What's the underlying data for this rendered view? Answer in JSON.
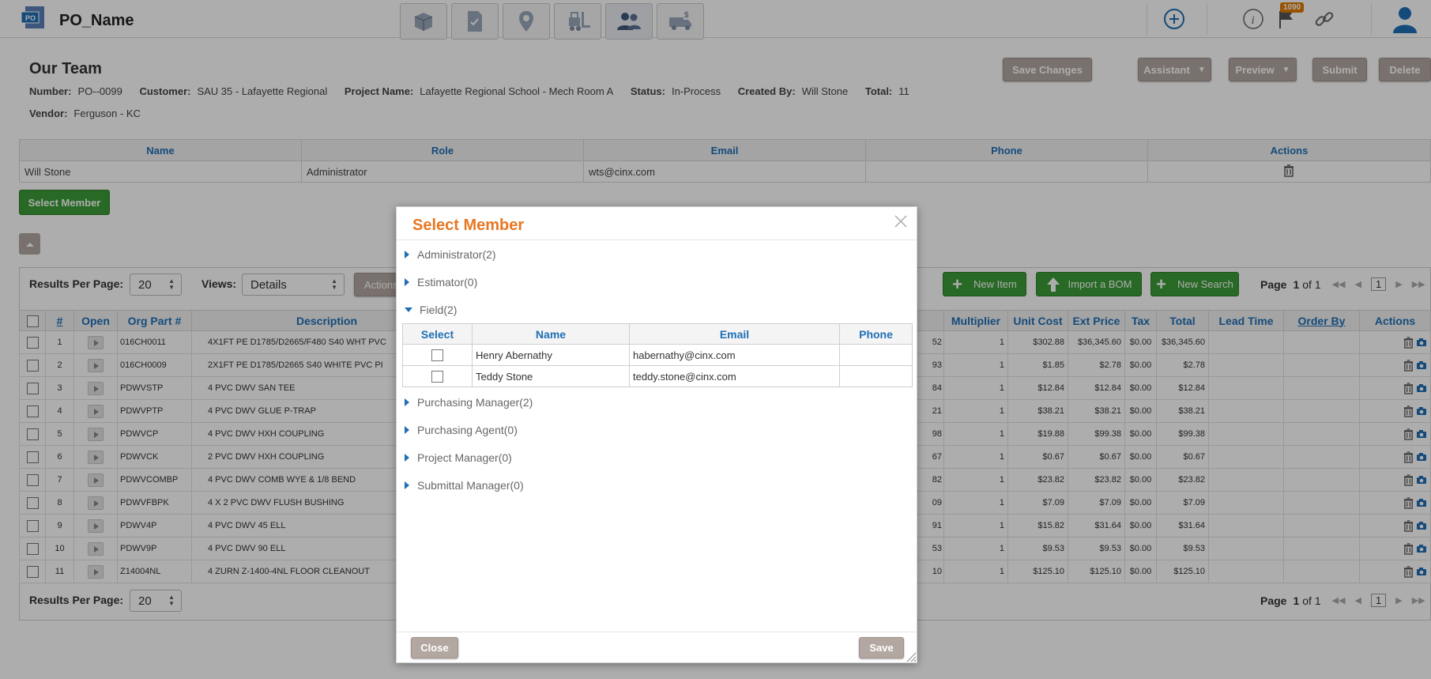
{
  "app": {
    "title": "PO_Name",
    "logo_text": "PO",
    "notification_count": "1090",
    "nav_icons": [
      "package-icon",
      "document-icon",
      "location-pin-icon",
      "forklift-icon",
      "team-icon",
      "truck-dollar-icon"
    ],
    "active_nav": "team-icon"
  },
  "header": {
    "title": "Our Team",
    "number_label": "Number:",
    "number": "PO--0099",
    "customer_label": "Customer:",
    "customer": "SAU 35 - Lafayette Regional",
    "project_label": "Project Name:",
    "project": "Lafayette Regional School - Mech Room A",
    "status_label": "Status:",
    "status": "In-Process",
    "created_label": "Created By:",
    "created_by": "Will Stone",
    "total_label": "Total:",
    "total": "11",
    "vendor_label": "Vendor:",
    "vendor": "Ferguson - KC",
    "buttons": {
      "save_changes": "Save Changes",
      "assistant": "Assistant",
      "preview": "Preview",
      "submit": "Submit",
      "delete": "Delete"
    }
  },
  "team": {
    "columns": [
      "Name",
      "Role",
      "Email",
      "Phone",
      "Actions"
    ],
    "rows": [
      {
        "name": "Will Stone",
        "role": "Administrator",
        "email": "wts@cinx.com",
        "phone": ""
      }
    ],
    "select_member_label": "Select Member"
  },
  "items": {
    "results_per_page_label": "Results Per Page:",
    "results_per_page": "20",
    "views_label": "Views:",
    "views_value": "Details",
    "actions_label": "Actions",
    "new_item": "New Item",
    "import_bom": "Import a BOM",
    "new_search": "New Search",
    "page_label": "Page",
    "page": "1",
    "of_label": "of 1",
    "columns_left": [
      "#",
      "Open",
      "Org Part #",
      "Description"
    ],
    "columns_right": [
      "Multiplier",
      "Unit Cost",
      "Ext Price",
      "Tax",
      "Total",
      "Lead Time",
      "Order By",
      "Actions"
    ],
    "rows": [
      {
        "n": "1",
        "part": "016CH0011",
        "desc": "4X1FT PE D1785/D2665/F480 S40 WHT PVC",
        "qty_frag": "52",
        "mult": "1",
        "unit": "$302.88",
        "ext": "$36,345.60",
        "tax": "$0.00",
        "total": "$36,345.60"
      },
      {
        "n": "2",
        "part": "016CH0009",
        "desc": "2X1FT PE D1785/D2665 S40 WHITE PVC PI",
        "qty_frag": "93",
        "mult": "1",
        "unit": "$1.85",
        "ext": "$2.78",
        "tax": "$0.00",
        "total": "$2.78"
      },
      {
        "n": "3",
        "part": "PDWVSTP",
        "desc": "4 PVC DWV SAN TEE",
        "qty_frag": "84",
        "mult": "1",
        "unit": "$12.84",
        "ext": "$12.84",
        "tax": "$0.00",
        "total": "$12.84"
      },
      {
        "n": "4",
        "part": "PDWVPTP",
        "desc": "4 PVC DWV GLUE P-TRAP",
        "qty_frag": "21",
        "mult": "1",
        "unit": "$38.21",
        "ext": "$38.21",
        "tax": "$0.00",
        "total": "$38.21"
      },
      {
        "n": "5",
        "part": "PDWVCP",
        "desc": "4 PVC DWV HXH COUPLING",
        "qty_frag": "98",
        "mult": "1",
        "unit": "$19.88",
        "ext": "$99.38",
        "tax": "$0.00",
        "total": "$99.38"
      },
      {
        "n": "6",
        "part": "PDWVCK",
        "desc": "2 PVC DWV HXH COUPLING",
        "qty_frag": "67",
        "mult": "1",
        "unit": "$0.67",
        "ext": "$0.67",
        "tax": "$0.00",
        "total": "$0.67"
      },
      {
        "n": "7",
        "part": "PDWVCOMBP",
        "desc": "4 PVC DWV COMB WYE & 1/8 BEND",
        "qty_frag": "82",
        "mult": "1",
        "unit": "$23.82",
        "ext": "$23.82",
        "tax": "$0.00",
        "total": "$23.82"
      },
      {
        "n": "8",
        "part": "PDWVFBPK",
        "desc": "4 X 2 PVC DWV FLUSH BUSHING",
        "qty_frag": "09",
        "mult": "1",
        "unit": "$7.09",
        "ext": "$7.09",
        "tax": "$0.00",
        "total": "$7.09"
      },
      {
        "n": "9",
        "part": "PDWV4P",
        "desc": "4 PVC DWV 45 ELL",
        "qty_frag": "91",
        "mult": "1",
        "unit": "$15.82",
        "ext": "$31.64",
        "tax": "$0.00",
        "total": "$31.64"
      },
      {
        "n": "10",
        "part": "PDWV9P",
        "desc": "4 PVC DWV 90 ELL",
        "qty_frag": "53",
        "mult": "1",
        "unit": "$9.53",
        "ext": "$9.53",
        "tax": "$0.00",
        "total": "$9.53"
      },
      {
        "n": "11",
        "part": "Z14004NL",
        "desc": "4 ZURN Z-1400-4NL FLOOR CLEANOUT",
        "qty_frag": "10",
        "mult": "1",
        "unit": "$125.10",
        "ext": "$125.10",
        "tax": "$0.00",
        "total": "$125.10"
      }
    ]
  },
  "modal": {
    "title": "Select Member",
    "groups": [
      {
        "label": "Administrator(2)",
        "expanded": false
      },
      {
        "label": "Estimator(0)",
        "expanded": false
      },
      {
        "label": "Field(2)",
        "expanded": true
      },
      {
        "label": "Purchasing Manager(2)",
        "expanded": false
      },
      {
        "label": "Purchasing Agent(0)",
        "expanded": false
      },
      {
        "label": "Project Manager(0)",
        "expanded": false
      },
      {
        "label": "Submittal Manager(0)",
        "expanded": false
      }
    ],
    "table": {
      "columns": [
        "Select",
        "Name",
        "Email",
        "Phone"
      ],
      "rows": [
        {
          "name": "Henry Abernathy",
          "email": "habernathy@cinx.com",
          "phone": ""
        },
        {
          "name": "Teddy Stone",
          "email": "teddy.stone@cinx.com",
          "phone": ""
        }
      ]
    },
    "close_label": "Close",
    "save_label": "Save"
  },
  "colors": {
    "accent_blue": "#1f6fb5",
    "brand_orange": "#e87722",
    "muted_button": "#b3a7a1",
    "green_button": "#3c9b37"
  }
}
